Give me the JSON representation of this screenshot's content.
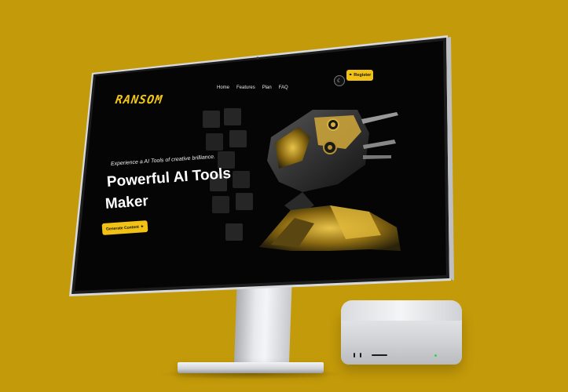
{
  "brand": {
    "logo_text": "RANSOM",
    "accent": "#F2C115",
    "background": "#C39A09"
  },
  "nav": {
    "items": [
      "Home",
      "Features",
      "Plan",
      "FAQ"
    ]
  },
  "header": {
    "register_label": "Register"
  },
  "hero": {
    "tagline": "Experience a AI Tools of creative brilliance.",
    "headline_line1": "Powerful AI Tools",
    "headline_line2": "Maker",
    "cta_label": "Generate Content"
  },
  "icons": {
    "theme_toggle": "moon-icon",
    "register": "link-icon",
    "cta": "sparkle-icon"
  }
}
